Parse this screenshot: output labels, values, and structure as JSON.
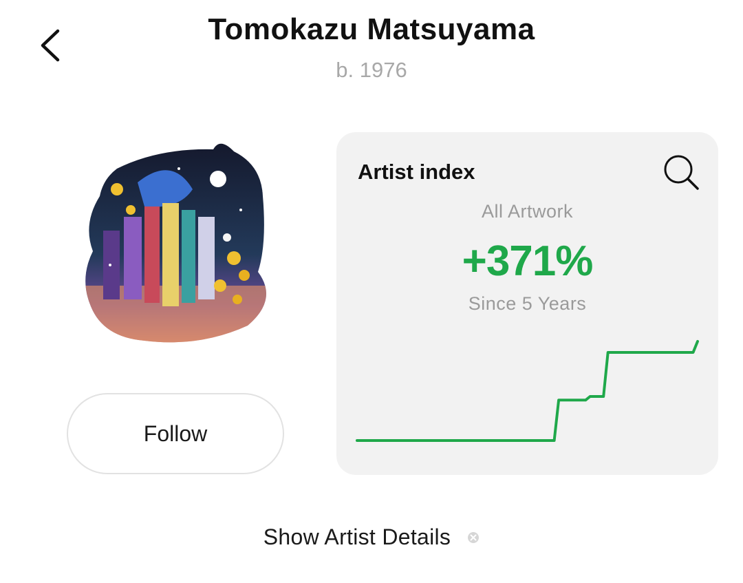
{
  "header": {
    "back_icon": "chevron-left-icon",
    "artist_name": "Tomokazu Matsuyama",
    "born": "b. 1976"
  },
  "artwork": {
    "description_icon": "artwork-image"
  },
  "follow": {
    "label": "Follow"
  },
  "artist_index": {
    "title": "Artist index",
    "search_icon": "search-icon",
    "scope": "All Artwork",
    "change": "+371%",
    "period": "Since 5 Years",
    "accent_color": "#1fa84a",
    "card_color": "#f2f2f2"
  },
  "chart_data": {
    "type": "line",
    "title": "",
    "xlabel": "",
    "ylabel": "",
    "grid": false,
    "series": [
      {
        "values": [
          1.0,
          1.0,
          1.0,
          1.0,
          1.0,
          1.0,
          1.0,
          1.0,
          1.0,
          1.0,
          1.0,
          1.0,
          1.0,
          1.0,
          1.0,
          1.0,
          1.0,
          1.0,
          1.0,
          1.0,
          1.0,
          1.0,
          1.0,
          1.0,
          1.0,
          1.0,
          1.0,
          1.0,
          1.0,
          1.0,
          1.0,
          1.0,
          1.0,
          1.0,
          1.0,
          1.0,
          1.0,
          1.0,
          1.0,
          1.0,
          1.0,
          1.0,
          1.0,
          1.0,
          1.0,
          2.1,
          2.1,
          2.1,
          2.1,
          2.1,
          2.1,
          2.1,
          2.2,
          2.2,
          2.2,
          2.2,
          3.4,
          3.4,
          3.4,
          3.4,
          3.4,
          3.4,
          3.4,
          3.4,
          3.4,
          3.4,
          3.4,
          3.4,
          3.4,
          3.4,
          3.4,
          3.4,
          3.4,
          3.4,
          3.4,
          3.4,
          3.7
        ],
        "color": "#1fa84a"
      }
    ]
  },
  "footer": {
    "details_label": "Show Artist Details",
    "details_icon": "close-circle-icon"
  }
}
